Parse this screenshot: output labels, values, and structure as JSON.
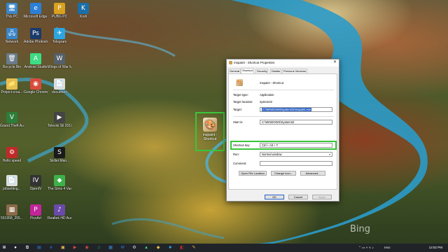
{
  "desktop": {
    "icons": [
      {
        "label": "This PC",
        "glyph": "🖥",
        "color": "#3a86c8"
      },
      {
        "label": "Microsoft Edge Beta",
        "glyph": "e",
        "color": "#2b7fd6"
      },
      {
        "label": "PUBG PC",
        "glyph": "P",
        "color": "#d8a21f"
      },
      {
        "label": "Kodi",
        "glyph": "K",
        "color": "#1b6fa8"
      },
      {
        "label": "Network",
        "glyph": "🖧",
        "color": "#3a86c8"
      },
      {
        "label": "Adobe Photosho...",
        "glyph": "Ps",
        "color": "#1a3a6a"
      },
      {
        "label": "Telegram",
        "glyph": "✈",
        "color": "#2ca5e0"
      },
      {
        "label": "Recycle Bin",
        "glyph": "🗑",
        "color": "#6a7a8a"
      },
      {
        "label": "Android Studio",
        "glyph": "A",
        "color": "#3ddc84"
      },
      {
        "label": "Wings of War Modern Wa...",
        "glyph": "W",
        "color": "#55606a"
      },
      {
        "label": "Project-crea...",
        "glyph": "📁",
        "color": "#e6c050"
      },
      {
        "label": "Google Chrome",
        "glyph": "◉",
        "color": "#d84b3a"
      },
      {
        "label": "document",
        "glyph": "📄",
        "color": "#dddddd"
      },
      {
        "label": "Grand Theft Auto V",
        "glyph": "V",
        "color": "#2e7d3a"
      },
      {
        "label": "Televisi Sil 2018 Ind...",
        "glyph": "▶",
        "color": "#444444"
      },
      {
        "label": "Hello speed",
        "glyph": "⚙",
        "color": "#c02a2a"
      },
      {
        "label": "Skillet Man...",
        "glyph": "S",
        "color": "#1a1a1a"
      },
      {
        "label": "jobsetting...",
        "glyph": "📄",
        "color": "#dddddd"
      },
      {
        "label": "OpenIV",
        "glyph": "IV",
        "color": "#333333"
      },
      {
        "label": "The Sims 4 Vasi 2019",
        "glyph": "◆",
        "color": "#3db04a"
      },
      {
        "label": "551958_255...",
        "glyph": "▦",
        "color": "#8a6a4a"
      },
      {
        "label": "PicsArt",
        "glyph": "P",
        "color": "#c2249a"
      },
      {
        "label": "Realtek HD Audio Ma...",
        "glyph": "♪",
        "color": "#6a4aa8"
      }
    ],
    "selected_icon": {
      "label": "mspaint - Shortcut",
      "glyph": "🎨"
    }
  },
  "dialog": {
    "title": "mspaint - Shortcut Properties",
    "close_glyph": "✕",
    "tabs": [
      "General",
      "Shortcut",
      "Security",
      "Details",
      "Previous Versions"
    ],
    "active_tab": "Shortcut",
    "app_name": "mspaint - Shortcut",
    "target_type_label": "Target type:",
    "target_type_value": "Application",
    "target_location_label": "Target location:",
    "target_location_value": "system32",
    "target_label": "Target:",
    "target_value": "C:\\WINDOWS\\system32\\mspaint.exe",
    "start_in_label": "Start in:",
    "start_in_value": "C:\\WINDOWS\\System32",
    "shortcut_key_label": "Shortcut key:",
    "shortcut_key_value": "Ctrl + Alt + T",
    "run_label": "Run:",
    "run_value": "Normal window",
    "comment_label": "Comment:",
    "comment_value": "",
    "open_file_location": "Open File Location",
    "change_icon": "Change Icon...",
    "advanced": "Advanced...",
    "ok": "OK",
    "cancel": "Cancel",
    "apply": "Apply"
  },
  "watermark": "Bing",
  "taskbar": {
    "items": [
      {
        "glyph": "●",
        "color": "#ffffff",
        "name": "cortana-icon"
      },
      {
        "glyph": "⧉",
        "color": "#ffffff",
        "name": "task-view-icon"
      },
      {
        "glyph": "▤",
        "color": "#2b7fd6",
        "name": "taskbar-app-1"
      },
      {
        "glyph": "e",
        "color": "#2b7fd6",
        "name": "edge-icon"
      },
      {
        "glyph": "▣",
        "color": "#e6c050",
        "name": "file-explorer-icon"
      },
      {
        "glyph": "▶",
        "color": "#d84b3a",
        "name": "taskbar-app-2"
      },
      {
        "glyph": "◉",
        "color": "#d84b3a",
        "name": "chrome-icon"
      },
      {
        "glyph": "♫",
        "color": "#1db954",
        "name": "taskbar-app-3"
      },
      {
        "glyph": "▦",
        "color": "#3a86c8",
        "name": "taskbar-app-4"
      },
      {
        "glyph": "✉",
        "color": "#2b7fd6",
        "name": "mail-icon"
      },
      {
        "glyph": "⚙",
        "color": "#dddddd",
        "name": "taskbar-app-5"
      },
      {
        "glyph": "▲",
        "color": "#3ddc84",
        "name": "taskbar-app-6"
      },
      {
        "glyph": "◆",
        "color": "#e6c050",
        "name": "taskbar-app-7"
      },
      {
        "glyph": "■",
        "color": "#2ca5e0",
        "name": "taskbar-app-8"
      },
      {
        "glyph": "◧",
        "color": "#c02a2a",
        "name": "taskbar-app-9"
      },
      {
        "glyph": "✎",
        "color": "#e6c050",
        "name": "taskbar-app-10"
      }
    ],
    "tray": "⌃ ▭ ◖ ∿ ♪",
    "language": "ENG",
    "clock": "12:52 PM"
  }
}
